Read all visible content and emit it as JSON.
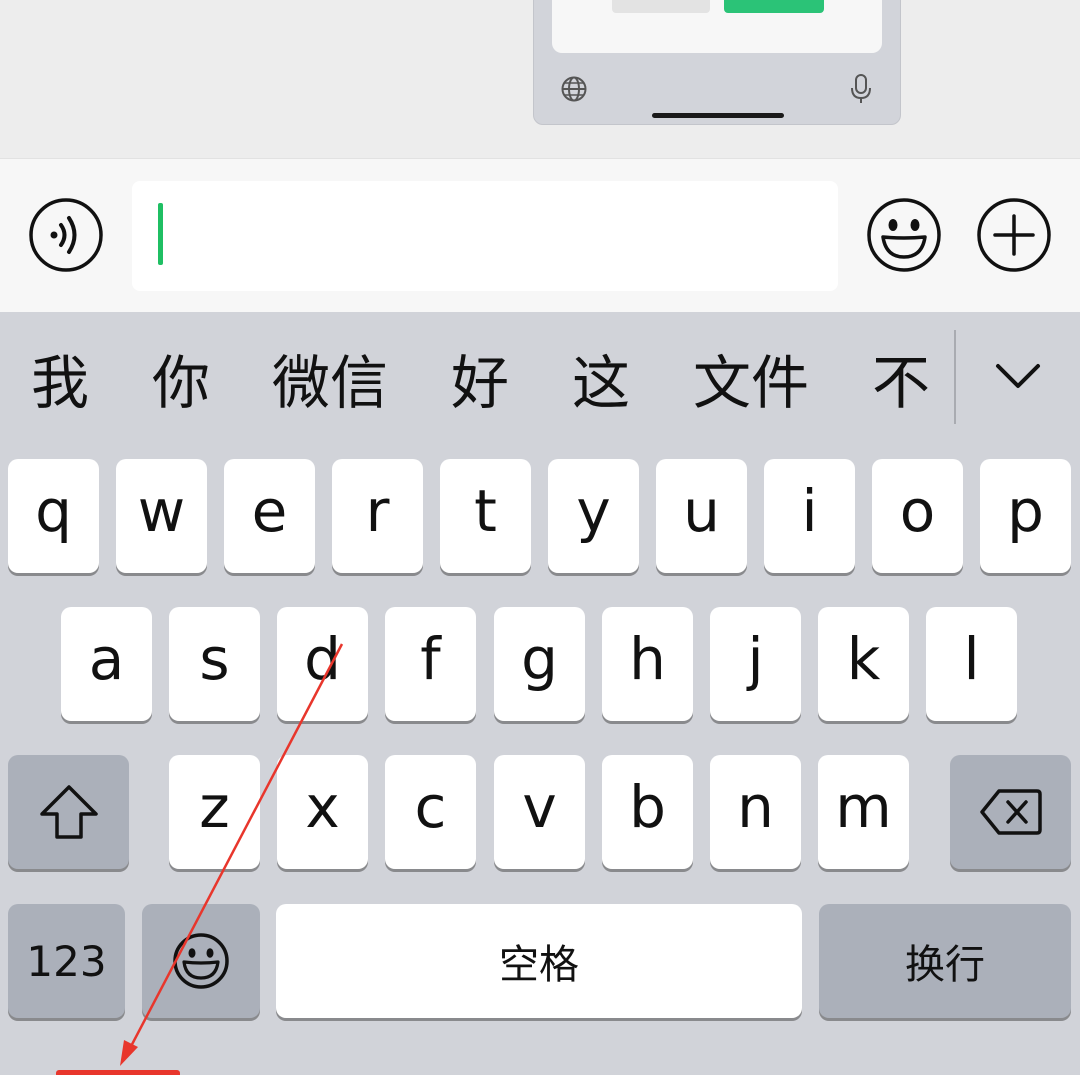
{
  "candidates": [
    "我",
    "你",
    "微信",
    "好",
    "这",
    "文件",
    "不"
  ],
  "rows": {
    "row1": [
      "q",
      "w",
      "e",
      "r",
      "t",
      "y",
      "u",
      "i",
      "o",
      "p"
    ],
    "row2": [
      "a",
      "s",
      "d",
      "f",
      "g",
      "h",
      "j",
      "k",
      "l"
    ],
    "row3": [
      "z",
      "x",
      "c",
      "v",
      "b",
      "n",
      "m"
    ]
  },
  "bottom": {
    "numbers_label": "123",
    "space_label": "空格",
    "return_label": "换行"
  },
  "icons": {
    "voice": "voice-wave-icon",
    "emoji": "emoji-smile-icon",
    "plus": "plus-circle-icon",
    "shift": "shift-arrow-icon",
    "delete": "backspace-icon",
    "emoji_key": "emoji-smile-icon",
    "globe": "globe-icon",
    "mic": "microphone-icon",
    "collapse": "chevron-down-icon"
  },
  "colors": {
    "caret": "#1fbf63",
    "keyboard_bg": "#d1d3d9",
    "func_key": "#abb0ba",
    "annotation": "#e8362c"
  }
}
